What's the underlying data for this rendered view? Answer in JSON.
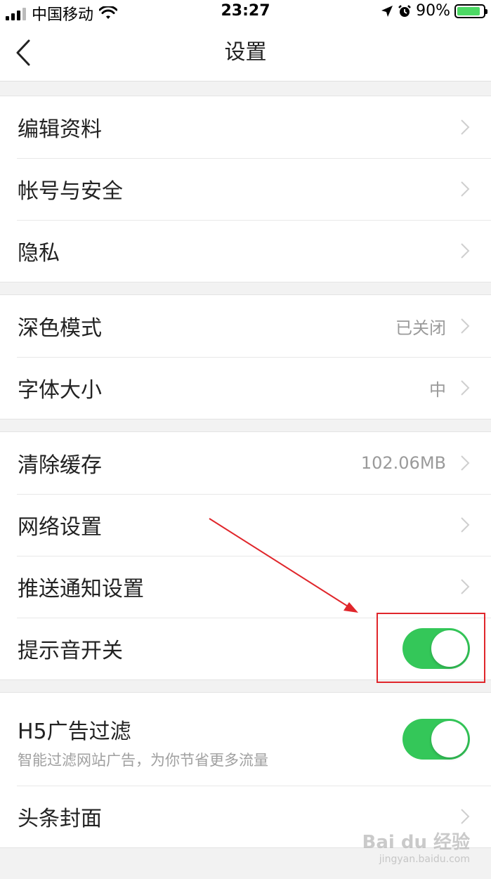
{
  "status_bar": {
    "carrier": "中国移动",
    "time": "23:27",
    "battery": "90%"
  },
  "navbar": {
    "title": "设置"
  },
  "groups": [
    {
      "rows": [
        {
          "label": "编辑资料"
        },
        {
          "label": "帐号与安全"
        },
        {
          "label": "隐私"
        }
      ]
    },
    {
      "rows": [
        {
          "label": "深色模式",
          "value": "已关闭"
        },
        {
          "label": "字体大小",
          "value": "中"
        }
      ]
    },
    {
      "rows": [
        {
          "label": "清除缓存",
          "value": "102.06MB"
        },
        {
          "label": "网络设置"
        },
        {
          "label": "推送通知设置"
        },
        {
          "label": "提示音开关",
          "toggle_on": true
        }
      ]
    },
    {
      "rows": [
        {
          "label": "H5广告过滤",
          "sublabel": "智能过滤网站广告，为你节省更多流量",
          "toggle_on": true
        },
        {
          "label": "头条封面"
        }
      ]
    }
  ],
  "watermark": {
    "brand": "Bai du 经验",
    "url": "jingyan.baidu.com"
  },
  "colors": {
    "toggle_on": "#34c759",
    "annotation": "#e0262b"
  }
}
